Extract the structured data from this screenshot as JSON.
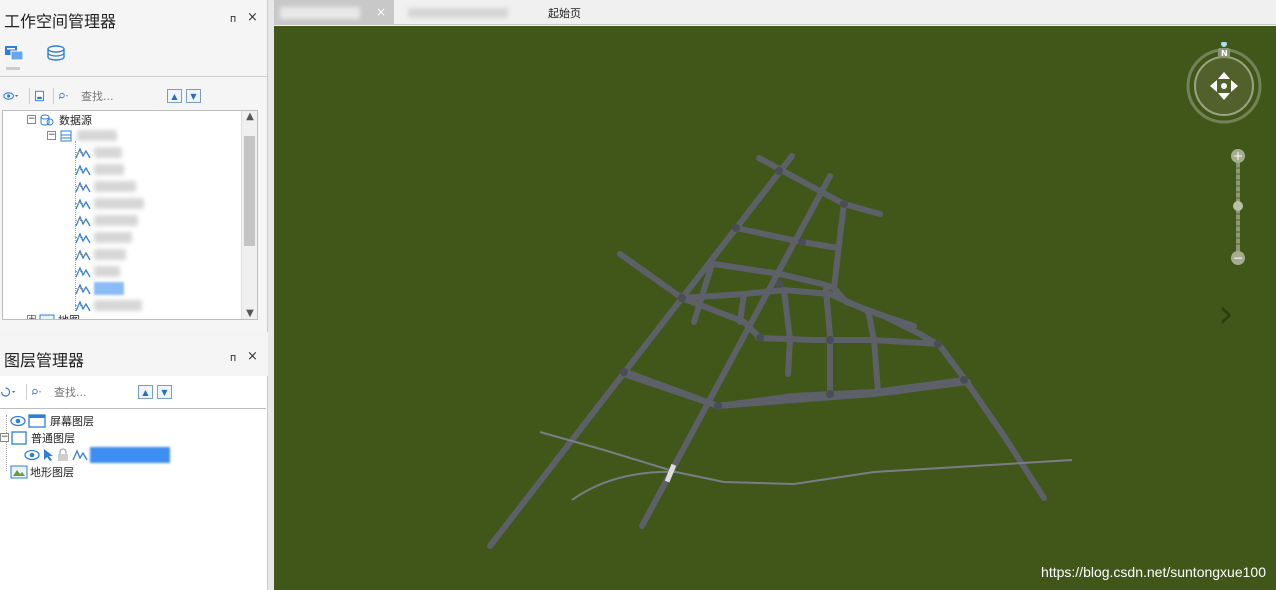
{
  "workspace": {
    "title": "工作空间管理器",
    "pin_glyph": "ᴨ",
    "close_glyph": "×",
    "search_placeholder": "查找...",
    "tree": {
      "datasource_label": "数据源",
      "map_label": "地图"
    }
  },
  "layers": {
    "title": "图层管理器",
    "pin_glyph": "ᴨ",
    "close_glyph": "×",
    "search_placeholder": "查找...",
    "screen_layer": "屏幕图层",
    "normal_layer": "普通图层",
    "terrain_layer": "地形图层"
  },
  "tabs": {
    "active_close": "×",
    "start_page": "起始页"
  },
  "scene": {
    "compass_label": "N",
    "prev_arrow": "‹",
    "next_arrow": "›",
    "watermark": "https://blog.csdn.net/suntongxue100"
  },
  "colors": {
    "scene_bg": "#405719",
    "road": "#5d6068",
    "accent_blue": "#3d8ef0"
  }
}
